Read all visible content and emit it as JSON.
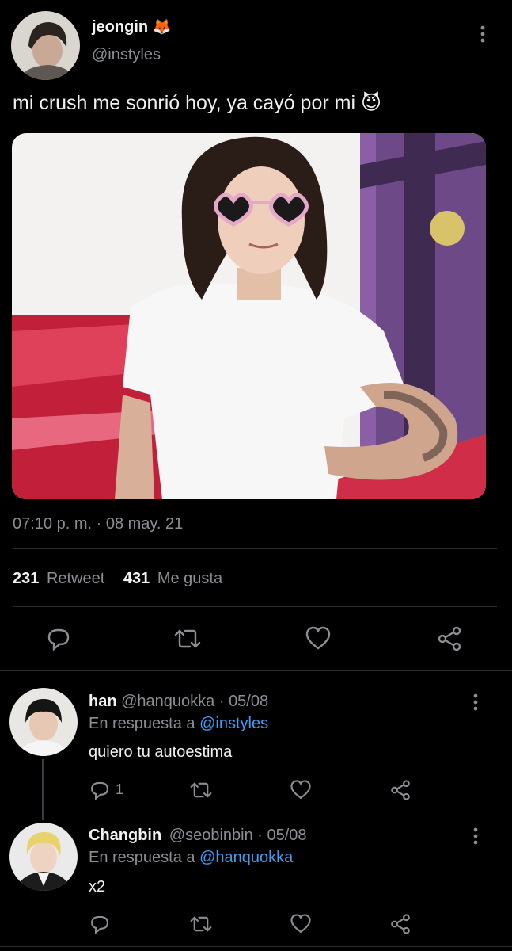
{
  "tweet": {
    "display_name": "jeongin",
    "name_emoji": "🦊",
    "handle": "@instyles",
    "text": "mi crush me sonrió hoy, ya cayó por mi",
    "text_emoji": "😈",
    "timestamp": "07:10 p. m. · 08 may. 21",
    "retweet_count": "231",
    "retweet_label": "Retweet",
    "like_count": "431",
    "like_label": "Me gusta"
  },
  "replies": [
    {
      "display_name": "han",
      "handle_date": "@hanquokka · 05/08",
      "reply_prefix": "En respuesta a",
      "reply_to": "@instyles",
      "text": "quiero tu autoestima",
      "reply_count": "1"
    },
    {
      "display_name": "Changbin",
      "handle_date": "@seobinbin · 05/08",
      "reply_prefix": "En respuesta a",
      "reply_to": "@hanquokka",
      "text": "x2",
      "reply_count": ""
    }
  ],
  "icons": {
    "more": "more-vertical-icon",
    "reply": "reply-icon",
    "retweet": "retweet-icon",
    "like": "heart-icon",
    "share": "share-icon"
  },
  "colors": {
    "background": "#000000",
    "text": "#e7e9ea",
    "muted": "#8b8f94",
    "link": "#3d9df0",
    "divider": "#2a2d31"
  }
}
